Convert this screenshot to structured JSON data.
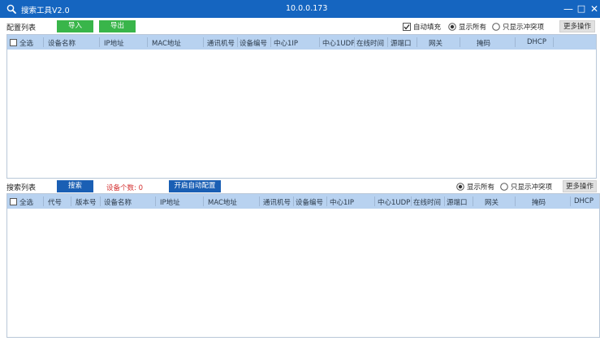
{
  "titlebar": {
    "title": "搜索工具V2.0",
    "ip": "10.0.0.173",
    "minimize": "—",
    "maximize": "□",
    "close": "✕"
  },
  "config": {
    "section_label": "配置列表",
    "import_label": "导入",
    "export_label": "导出",
    "autofill_label": "自动填充",
    "show_all_label": "显示所有",
    "show_conflict_label": "只显示冲突项",
    "more_label": "更多操作",
    "columns": [
      "全选",
      "设备名称",
      "IP地址",
      "MAC地址",
      "通讯机号",
      "设备编号",
      "中心1IP",
      "中心1UDP",
      "在线时间",
      "源端口",
      "网关",
      "掩码",
      "DHCP"
    ]
  },
  "search": {
    "section_label": "搜索列表",
    "search_label": "搜索",
    "device_count_label": "设备个数:",
    "device_count": "0",
    "auto_config_label": "开启自动配置",
    "show_all_label": "显示所有",
    "show_conflict_label": "只显示冲突项",
    "more_label": "更多操作",
    "columns": [
      "全选",
      "代号",
      "版本号",
      "设备名称",
      "IP地址",
      "MAC地址",
      "通讯机号",
      "设备编号",
      "中心1IP",
      "中心1UDP",
      "在线时间",
      "源端口",
      "网关",
      "掩码",
      "DHCP"
    ]
  },
  "colors": {
    "titlebar": "#1565c0",
    "green_button": "#39b54a",
    "blue_button": "#1a5fb4",
    "grid_header": "#b8d2f0",
    "count_red": "#d32f2f"
  }
}
